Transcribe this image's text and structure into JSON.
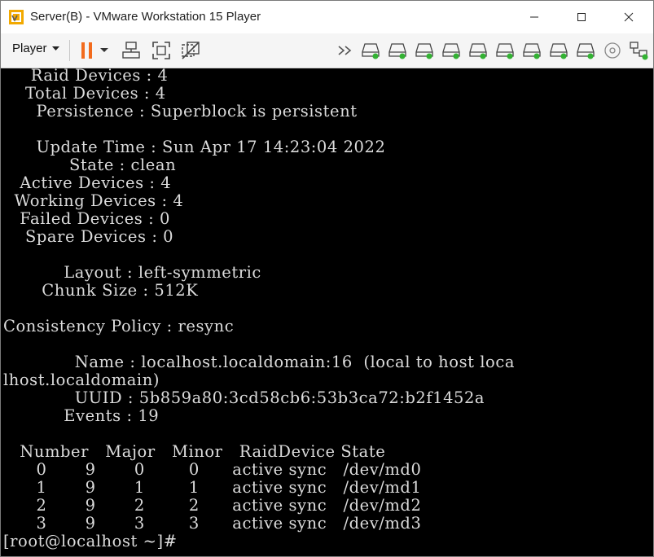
{
  "window": {
    "title": "Server(B) - VMware Workstation 15 Player"
  },
  "toolbar": {
    "player_label": "Player"
  },
  "console": {
    "lines": [
      "     Raid Devices : 4",
      "    Total Devices : 4",
      "      Persistence : Superblock is persistent",
      "",
      "      Update Time : Sun Apr 17 14:23:04 2022",
      "            State : clean",
      "   Active Devices : 4",
      "  Working Devices : 4",
      "   Failed Devices : 0",
      "    Spare Devices : 0",
      "",
      "           Layout : left-symmetric",
      "       Chunk Size : 512K",
      "",
      "Consistency Policy : resync",
      "",
      "             Name : localhost.localdomain:16  (local to host loca",
      "lhost.localdomain)",
      "             UUID : 5b859a80:3cd58cb6:53b3ca72:b2f1452a",
      "           Events : 19",
      "",
      "   Number   Major   Minor   RaidDevice State",
      "      0       9       0        0      active sync   /dev/md0",
      "      1       9       1        1      active sync   /dev/md1",
      "      2       9       2        2      active sync   /dev/md2",
      "      3       9       3        3      active sync   /dev/md3",
      "[root@localhost ~]#"
    ]
  }
}
